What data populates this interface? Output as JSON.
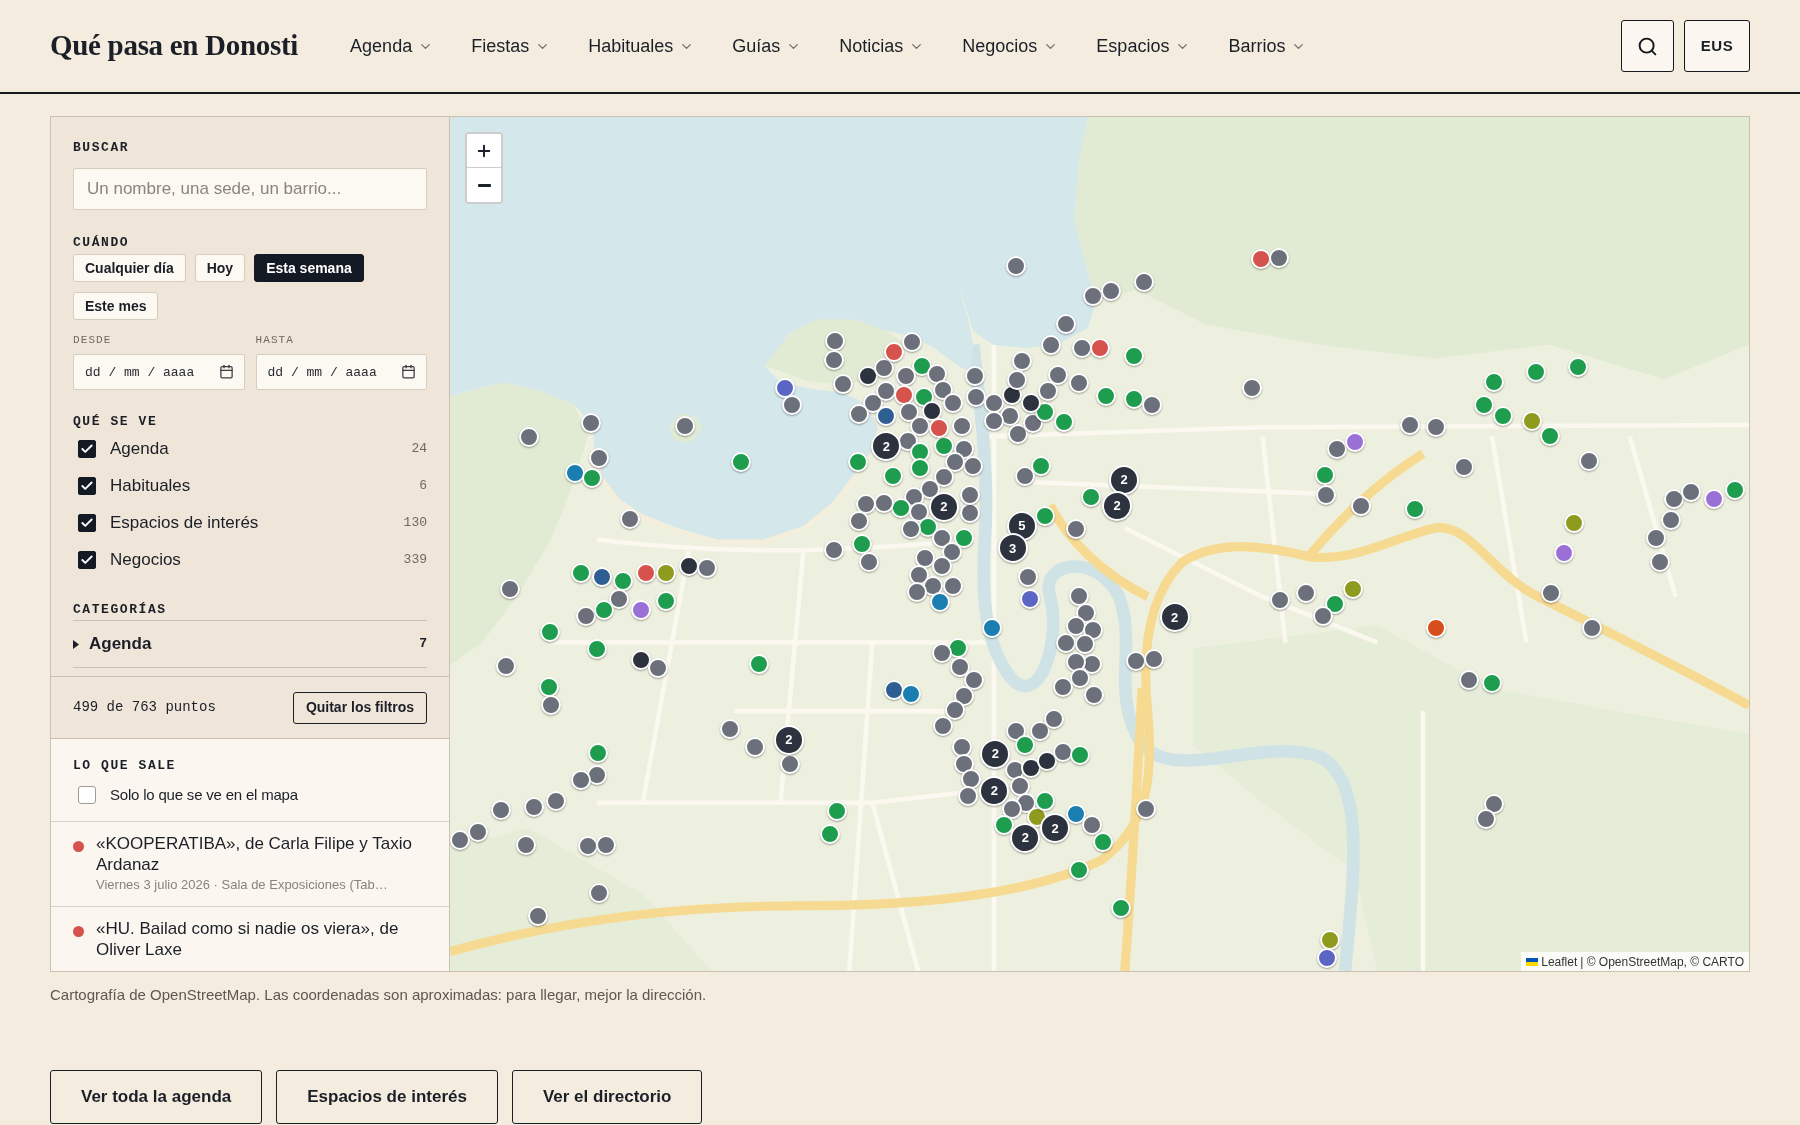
{
  "header": {
    "logo": "Qué pasa en Donosti",
    "nav": [
      {
        "label": "Agenda"
      },
      {
        "label": "Fiestas"
      },
      {
        "label": "Habituales"
      },
      {
        "label": "Guías"
      },
      {
        "label": "Noticias"
      },
      {
        "label": "Negocios"
      },
      {
        "label": "Espacios"
      },
      {
        "label": "Barrios"
      }
    ],
    "language_button": "EUS"
  },
  "filters": {
    "search": {
      "label": "BUSCAR",
      "placeholder": "Un nombre, una sede, un barrio..."
    },
    "when": {
      "label": "CUÁNDO",
      "options": [
        {
          "label": "Cualquier día",
          "selected": false
        },
        {
          "label": "Hoy",
          "selected": false
        },
        {
          "label": "Esta semana",
          "selected": true
        },
        {
          "label": "Este mes",
          "selected": false
        }
      ],
      "from": {
        "label": "DESDE",
        "placeholder": "dd / mm / aaaa"
      },
      "to": {
        "label": "HASTA",
        "placeholder": "dd / mm / aaaa"
      }
    },
    "layers": {
      "label": "QUÉ SE VE",
      "items": [
        {
          "label": "Agenda",
          "count": "24",
          "checked": true
        },
        {
          "label": "Habituales",
          "count": "6",
          "checked": true
        },
        {
          "label": "Espacios de interés",
          "count": "130",
          "checked": true
        },
        {
          "label": "Negocios",
          "count": "339",
          "checked": true
        }
      ]
    },
    "categories": {
      "label": "CATEGORÍAS",
      "items": [
        {
          "label": "Agenda",
          "count": "7",
          "expanded": false
        }
      ]
    }
  },
  "results_bar": {
    "summary": "499 de 763 puntos",
    "clear_button": "Quitar los filtros"
  },
  "listing": {
    "label": "LO QUE SALE",
    "map_only": {
      "label": "Solo lo que se ve en el mapa",
      "checked": false
    },
    "items": [
      {
        "title": "«KOOPERATIBA», de Carla Filipe y Taxio Ardanaz",
        "meta": "Viernes 3 julio 2026 · Sala de Exposiciones (Tab…",
        "color": "#d5524d"
      },
      {
        "title": "«HU. Bailad como si nadie os viera», de Oliver Laxe",
        "color": "#d5524d"
      }
    ]
  },
  "map": {
    "markers": [
      {
        "color": "#6b707b"
      },
      {
        "color": "#d5524d"
      },
      {
        "color": "#6b707b"
      },
      {
        "color": "#6b707b"
      },
      {
        "color": "#6b707b"
      },
      {
        "color": "#6b707b"
      },
      {
        "color": "#6b707b"
      },
      {
        "color": "#6b707b"
      },
      {
        "color": "#6b707b"
      },
      {
        "color": "#d5524d"
      },
      {
        "color": "#1f9d4f"
      },
      {
        "color": "#6b707b"
      },
      {
        "color": "#6b707b"
      },
      {
        "color": "#1f9d4f"
      },
      {
        "color": "#1f9d4f"
      },
      {
        "color": "#1f9d4f"
      },
      {
        "color": "#1f9d4f"
      },
      {
        "color": "#1f9d4f"
      },
      {
        "color": "#8e9b1f"
      },
      {
        "color": "#1f9d4f"
      },
      {
        "color": "#6b707b"
      },
      {
        "color": "#9b70d6"
      },
      {
        "color": "#6b707b"
      },
      {
        "color": "#6b707b"
      },
      {
        "color": "#6b707b"
      },
      {
        "color": "#6b707b"
      },
      {
        "color": "#1f9d4f"
      },
      {
        "color": "#6b707b"
      },
      {
        "color": "#6b707b"
      },
      {
        "color": "#1f9d4f"
      },
      {
        "color": "#6b707b"
      },
      {
        "color": "#6b707b"
      },
      {
        "color": "#9b70d6"
      },
      {
        "color": "#1f9d4f"
      },
      {
        "color": "#6b707b"
      },
      {
        "color": "#8e9b1f"
      },
      {
        "color": "#9b70d6"
      },
      {
        "color": "#6b707b"
      },
      {
        "color": "#6b707b"
      },
      {
        "color": "#6b707b"
      },
      {
        "color": "#6b707b"
      },
      {
        "color": "#1f9d4f"
      },
      {
        "color": "#8e9b1f"
      },
      {
        "color": "#6b707b"
      },
      {
        "color": "#6b707b"
      },
      {
        "color": "#d64f1b"
      },
      {
        "color": "#6b707b"
      },
      {
        "color": "#6b707b"
      },
      {
        "color": "#1f9d4f"
      },
      {
        "color": "#6b707b"
      },
      {
        "color": "#6b707b"
      },
      {
        "color": "#6b707b"
      },
      {
        "color": "#1f9d4f"
      },
      {
        "color": "#8e9b1f"
      },
      {
        "color": "#5b66c4"
      },
      {
        "color": "#6b707b"
      },
      {
        "color": "#6b707b"
      },
      {
        "color": "#6b707b"
      },
      {
        "color": "#1f9d4f"
      },
      {
        "color": "#1f9d4f"
      },
      {
        "color": "#1f9d4f"
      },
      {
        "color": "#6b707b"
      },
      {
        "color": "#6b707b"
      },
      {
        "color": "#6b707b"
      },
      {
        "color": "#5b66c4"
      },
      {
        "color": "#1a7fb0"
      },
      {
        "color": "#1f9d4f"
      },
      {
        "color": "#6b707b"
      },
      {
        "color": "#1f9d4f"
      },
      {
        "color": "#6b707b"
      },
      {
        "color": "#6b707b"
      },
      {
        "color": "#6b707b"
      },
      {
        "color": "#1a7fb0"
      },
      {
        "color": "#1f9d4f"
      },
      {
        "color": "#6b707b"
      },
      {
        "color": "#6b707b"
      },
      {
        "color": "#1f9d4f"
      },
      {
        "color": "#1f9d4f"
      },
      {
        "color": "#6b707b"
      },
      {
        "color": "#1f9d4f"
      },
      {
        "color": "#2f5e93"
      },
      {
        "color": "#1f9d4f"
      },
      {
        "color": "#d5524d"
      },
      {
        "color": "#8e9b1f"
      },
      {
        "color": "#6b707b"
      },
      {
        "color": "#9b70d6"
      },
      {
        "color": "#1f9d4f"
      },
      {
        "color": "#6b707b"
      },
      {
        "color": "#1f9d4f"
      },
      {
        "color": "#2c333e"
      },
      {
        "color": "#6b707b"
      },
      {
        "color": "#6b707b"
      },
      {
        "color": "#1f9d4f"
      },
      {
        "color": "#6b707b"
      },
      {
        "color": "#1f9d4f"
      },
      {
        "color": "#1f9d4f"
      },
      {
        "color": "#2c333e"
      },
      {
        "color": "#6b707b"
      },
      {
        "color": "#1f9d4f"
      },
      {
        "color": "#6b707b"
      },
      {
        "color": "#1f9d4f"
      },
      {
        "color": "#6b707b"
      },
      {
        "color": "#6b707b"
      },
      {
        "color": "#6b707b"
      },
      {
        "color": "#6b707b"
      },
      {
        "color": "#1f9d4f"
      },
      {
        "color": "#6b707b"
      },
      {
        "color": "#6b707b"
      },
      {
        "color": "#6b707b"
      },
      {
        "color": "#6b707b"
      },
      {
        "color": "#6b707b"
      },
      {
        "color": "#6b707b"
      },
      {
        "color": "#6b707b"
      },
      {
        "color": "#6b707b"
      },
      {
        "color": "#6b707b"
      },
      {
        "color": "#6b707b"
      },
      {
        "color": "#6b707b"
      },
      {
        "color": "#6b707b"
      },
      {
        "color": "#1f9d4f"
      },
      {
        "color": "#1f9d4f"
      },
      {
        "color": "#2f5e93"
      },
      {
        "color": "#1a7fb0"
      },
      {
        "color": "#5b66c4"
      },
      {
        "color": "#6b707b"
      },
      {
        "color": "#6b707b"
      },
      {
        "color": "#6b707b"
      },
      {
        "color": "#6b707b"
      },
      {
        "color": "#2c333e"
      },
      {
        "color": "#6b707b"
      },
      {
        "color": "#d5524d"
      },
      {
        "color": "#6b707b"
      },
      {
        "color": "#1f9d4f"
      },
      {
        "color": "#6b707b"
      },
      {
        "color": "#6b707b"
      },
      {
        "color": "#6b707b"
      },
      {
        "color": "#6b707b"
      },
      {
        "color": "#d5524d"
      },
      {
        "color": "#2f5e93"
      },
      {
        "color": "#6b707b"
      },
      {
        "color": "#6b707b"
      },
      {
        "color": "#1f9d4f"
      },
      {
        "color": "#6b707b"
      },
      {
        "color": "#6b707b"
      },
      {
        "color": "#2c333e"
      },
      {
        "color": "#6b707b"
      },
      {
        "color": "#6b707b"
      },
      {
        "color": "#6b707b"
      },
      {
        "color": "#1f9d4f"
      },
      {
        "color": "#d5524d"
      },
      {
        "color": "#6b707b"
      },
      {
        "color": "#6b707b"
      },
      {
        "color": "#6b707b"
      },
      {
        "color": "#1f9d4f"
      },
      {
        "color": "#1f9d4f"
      },
      {
        "color": "#1f9d4f"
      },
      {
        "color": "#6b707b"
      },
      {
        "color": "#6b707b"
      },
      {
        "color": "#6b707b"
      },
      {
        "color": "#1f9d4f"
      },
      {
        "color": "#6b707b"
      },
      {
        "color": "#6b707b"
      },
      {
        "color": "#6b707b"
      },
      {
        "color": "#6b707b"
      },
      {
        "color": "#6b707b"
      },
      {
        "color": "#6b707b"
      },
      {
        "color": "#1f9d4f"
      },
      {
        "color": "#6b707b"
      },
      {
        "color": "#6b707b"
      },
      {
        "color": "#1f9d4f"
      },
      {
        "color": "#6b707b"
      },
      {
        "color": "#6b707b"
      },
      {
        "color": "#6b707b"
      },
      {
        "color": "#6b707b"
      },
      {
        "color": "#6b707b"
      },
      {
        "color": "#6b707b"
      },
      {
        "color": "#6b707b"
      },
      {
        "color": "#1a7fb0"
      },
      {
        "color": "#1f9d4f"
      },
      {
        "color": "#6b707b"
      },
      {
        "color": "#6b707b"
      },
      {
        "color": "#6b707b"
      },
      {
        "color": "#6b707b"
      },
      {
        "color": "#6b707b"
      },
      {
        "color": "#6b707b"
      },
      {
        "color": "#6b707b"
      },
      {
        "color": "#6b707b"
      },
      {
        "color": "#6b707b"
      },
      {
        "color": "#2c333e"
      },
      {
        "color": "#6b707b"
      },
      {
        "color": "#6b707b"
      },
      {
        "color": "#6b707b"
      },
      {
        "color": "#6b707b"
      },
      {
        "color": "#6b707b"
      },
      {
        "color": "#6b707b"
      },
      {
        "color": "#1f9d4f"
      },
      {
        "color": "#1f9d4f"
      },
      {
        "color": "#2c333e"
      },
      {
        "color": "#6b707b"
      },
      {
        "color": "#6b707b"
      },
      {
        "color": "#6b707b"
      },
      {
        "color": "#6b707b"
      },
      {
        "color": "#6b707b"
      },
      {
        "color": "#6b707b"
      },
      {
        "color": "#6b707b"
      },
      {
        "color": "#6b707b"
      },
      {
        "color": "#6b707b"
      },
      {
        "color": "#6b707b"
      },
      {
        "color": "#6b707b"
      },
      {
        "color": "#6b707b"
      },
      {
        "color": "#6b707b"
      },
      {
        "color": "#6b707b"
      },
      {
        "color": "#6b707b"
      },
      {
        "color": "#6b707b"
      },
      {
        "color": "#6b707b"
      },
      {
        "color": "#6b707b"
      },
      {
        "color": "#1f9d4f"
      },
      {
        "color": "#6b707b"
      },
      {
        "color": "#2c333e"
      },
      {
        "color": "#2c333e"
      },
      {
        "color": "#6b707b"
      },
      {
        "color": "#1f9d4f"
      },
      {
        "color": "#6b707b"
      },
      {
        "color": "#6b707b"
      },
      {
        "color": "#6b707b"
      },
      {
        "color": "#6b707b"
      },
      {
        "color": "#8e9b1f"
      },
      {
        "color": "#1f9d4f"
      },
      {
        "color": "#1a7fb0"
      },
      {
        "color": "#6b707b"
      },
      {
        "color": "#1f9d4f"
      },
      {
        "color": "#1f9d4f"
      },
      {
        "color": "#1f9d4f"
      }
    ],
    "clusters": [
      {
        "count": "2"
      },
      {
        "count": "2"
      },
      {
        "count": "5"
      },
      {
        "count": "3"
      },
      {
        "count": "2"
      },
      {
        "count": "2"
      },
      {
        "count": "2"
      },
      {
        "count": "2"
      },
      {
        "count": "2"
      },
      {
        "count": "2"
      },
      {
        "count": "2"
      },
      {
        "count": "2"
      }
    ],
    "attribution": {
      "link": "Leaflet",
      "text": "| © OpenStreetMap, © CARTO"
    }
  },
  "caption": "Cartografía de OpenStreetMap. Las coordenadas son aproximadas: para llegar, mejor la dirección.",
  "footer_buttons": [
    "Ver toda la agenda",
    "Espacios de interés",
    "Ver el directorio"
  ]
}
